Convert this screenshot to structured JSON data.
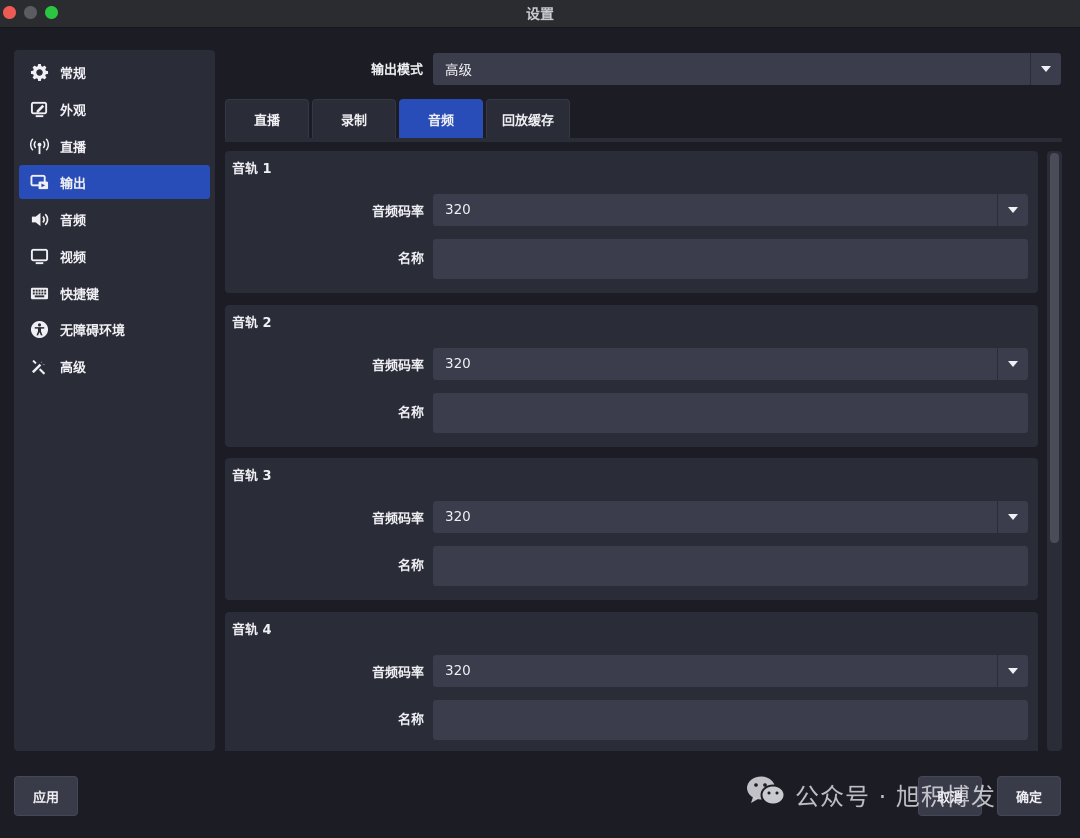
{
  "window": {
    "title": "设置"
  },
  "sidebar": {
    "items": [
      {
        "label": "常规",
        "icon": "gear-icon"
      },
      {
        "label": "外观",
        "icon": "appearance-icon"
      },
      {
        "label": "直播",
        "icon": "broadcast-icon"
      },
      {
        "label": "输出",
        "icon": "output-icon",
        "active": true
      },
      {
        "label": "音频",
        "icon": "speaker-icon"
      },
      {
        "label": "视频",
        "icon": "monitor-icon"
      },
      {
        "label": "快捷键",
        "icon": "keyboard-icon"
      },
      {
        "label": "无障碍环境",
        "icon": "accessibility-icon"
      },
      {
        "label": "高级",
        "icon": "tools-icon"
      }
    ]
  },
  "output_mode": {
    "label": "输出模式",
    "value": "高级"
  },
  "tabs": [
    {
      "label": "直播"
    },
    {
      "label": "录制"
    },
    {
      "label": "音频",
      "active": true
    },
    {
      "label": "回放缓存"
    }
  ],
  "tracks": [
    {
      "title": "音轨 1",
      "bitrate_label": "音频码率",
      "bitrate": "320",
      "name_label": "名称",
      "name": ""
    },
    {
      "title": "音轨 2",
      "bitrate_label": "音频码率",
      "bitrate": "320",
      "name_label": "名称",
      "name": ""
    },
    {
      "title": "音轨 3",
      "bitrate_label": "音频码率",
      "bitrate": "320",
      "name_label": "名称",
      "name": ""
    },
    {
      "title": "音轨 4",
      "bitrate_label": "音频码率",
      "bitrate": "320",
      "name_label": "名称",
      "name": ""
    }
  ],
  "footer": {
    "apply_label": "应用",
    "cancel_label": "取消",
    "ok_label": "确定"
  },
  "watermark": {
    "text": "公众号 · 旭积博发"
  },
  "colors": {
    "accent": "#284cb8",
    "panel": "#2a2c38",
    "field": "#3b3d4c",
    "background": "#1c1d24"
  }
}
